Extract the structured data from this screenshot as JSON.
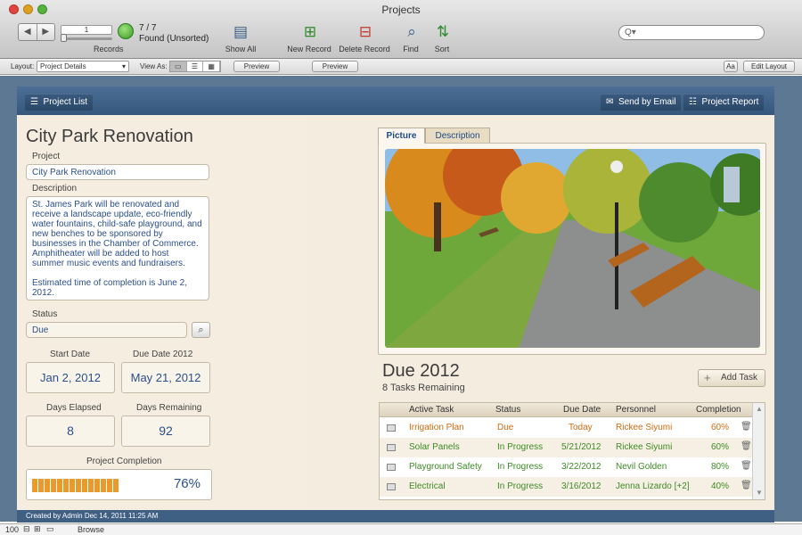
{
  "window": {
    "title": "Projects"
  },
  "toolbar": {
    "record_field": "1",
    "record_count": "7 / 7",
    "found_state": "Found (Unsorted)",
    "records_label": "Records",
    "show_all": "Show All",
    "new_record": "New Record",
    "delete_record": "Delete Record",
    "find": "Find",
    "sort": "Sort",
    "search_placeholder": "Q▾"
  },
  "layoutbar": {
    "layout_label": "Layout:",
    "layout_value": "Project Details",
    "view_as_label": "View As:",
    "preview_1": "Preview",
    "preview_2": "Preview",
    "aa": "Aa",
    "edit_layout": "Edit Layout"
  },
  "header": {
    "project_list": "Project List",
    "send_email": "Send by Email",
    "project_report": "Project Report"
  },
  "project": {
    "heading": "City Park Renovation",
    "project_label": "Project",
    "project_value": "City Park Renovation",
    "description_label": "Description",
    "description_p1": "St. James Park will be renovated and receive a landscape update, eco-friendly water fountains, child-safe playground, and new benches to be sponsored by businesses in the Chamber of Commerce. Amphitheater will be added to host summer music events and fundraisers.",
    "description_p2": "Estimated time of completion is June 2, 2012.",
    "status_label": "Status",
    "status_value": "Due",
    "start_date_label": "Start Date",
    "start_date": "Jan 2, 2012",
    "due_date_label": "Due Date 2012",
    "due_date": "May 21, 2012",
    "days_elapsed_label": "Days Elapsed",
    "days_elapsed": "8",
    "days_remaining_label": "Days Remaining",
    "days_remaining": "92",
    "completion_label": "Project Completion",
    "completion_value": "76%",
    "completion_fraction": 0.76
  },
  "tabs": {
    "picture": "Picture",
    "description": "Description"
  },
  "tasks": {
    "heading": "Due 2012",
    "remaining": "8 Tasks Remaining",
    "add_task": "Add Task",
    "columns": [
      "Active Task",
      "Status",
      "Due Date",
      "Personnel",
      "Completion"
    ],
    "rows": [
      {
        "task": "Irrigation Plan",
        "status": "Due",
        "due": "Today",
        "person": "Rickee Siyumi",
        "completion": "60%",
        "color": "#d36b12"
      },
      {
        "task": "Solar Panels",
        "status": "In Progress",
        "due": "5/21/2012",
        "person": "Rickee Siyumi",
        "completion": "60%",
        "color": "#3d8a25"
      },
      {
        "task": "Playground Safety",
        "status": "In Progress",
        "due": "3/22/2012",
        "person": "Nevil Golden",
        "completion": "80%",
        "color": "#3d8a25"
      },
      {
        "task": "Electrical",
        "status": "In Progress",
        "due": "3/16/2012",
        "person": "Jenna Lizardo [+2]",
        "completion": "40%",
        "color": "#3d8a25"
      }
    ]
  },
  "footer": {
    "created": "Created by Admin Dec 14, 2011 11:25 AM"
  },
  "statusbar": {
    "zoom": "100",
    "mode": "Browse"
  }
}
